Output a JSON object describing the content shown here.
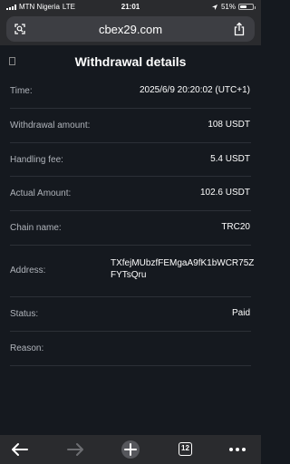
{
  "status_bar": {
    "carrier": "MTN Nigeria",
    "network": "LTE",
    "time": "21:01",
    "battery_percent": "51%",
    "battery_level": 0.51
  },
  "browser": {
    "url": "cbex29.com",
    "tab_count": "12"
  },
  "page": {
    "title": "Withdrawal details",
    "rows": [
      {
        "label": "Time:",
        "value": "2025/6/9 20:20:02 (UTC+1)"
      },
      {
        "label": "Withdrawal amount:",
        "value": "108 USDT"
      },
      {
        "label": "Handling fee:",
        "value": "5.4 USDT"
      },
      {
        "label": "Actual Amount:",
        "value": "102.6 USDT"
      },
      {
        "label": "Chain name:",
        "value": "TRC20"
      },
      {
        "label": "Address:",
        "value": "TXfejMUbzfFEMgaA9fK1bWCR75ZFYTsQru"
      },
      {
        "label": "Status:",
        "value": "Paid"
      },
      {
        "label": "Reason:",
        "value": ""
      }
    ]
  },
  "icons": {
    "url_left": "page-settings-icon",
    "url_right": "share-icon",
    "back": "back-arrow-icon",
    "forward": "forward-arrow-icon",
    "new_tab": "plus-icon",
    "tabs": "tabs-icon",
    "more": "more-icon"
  }
}
